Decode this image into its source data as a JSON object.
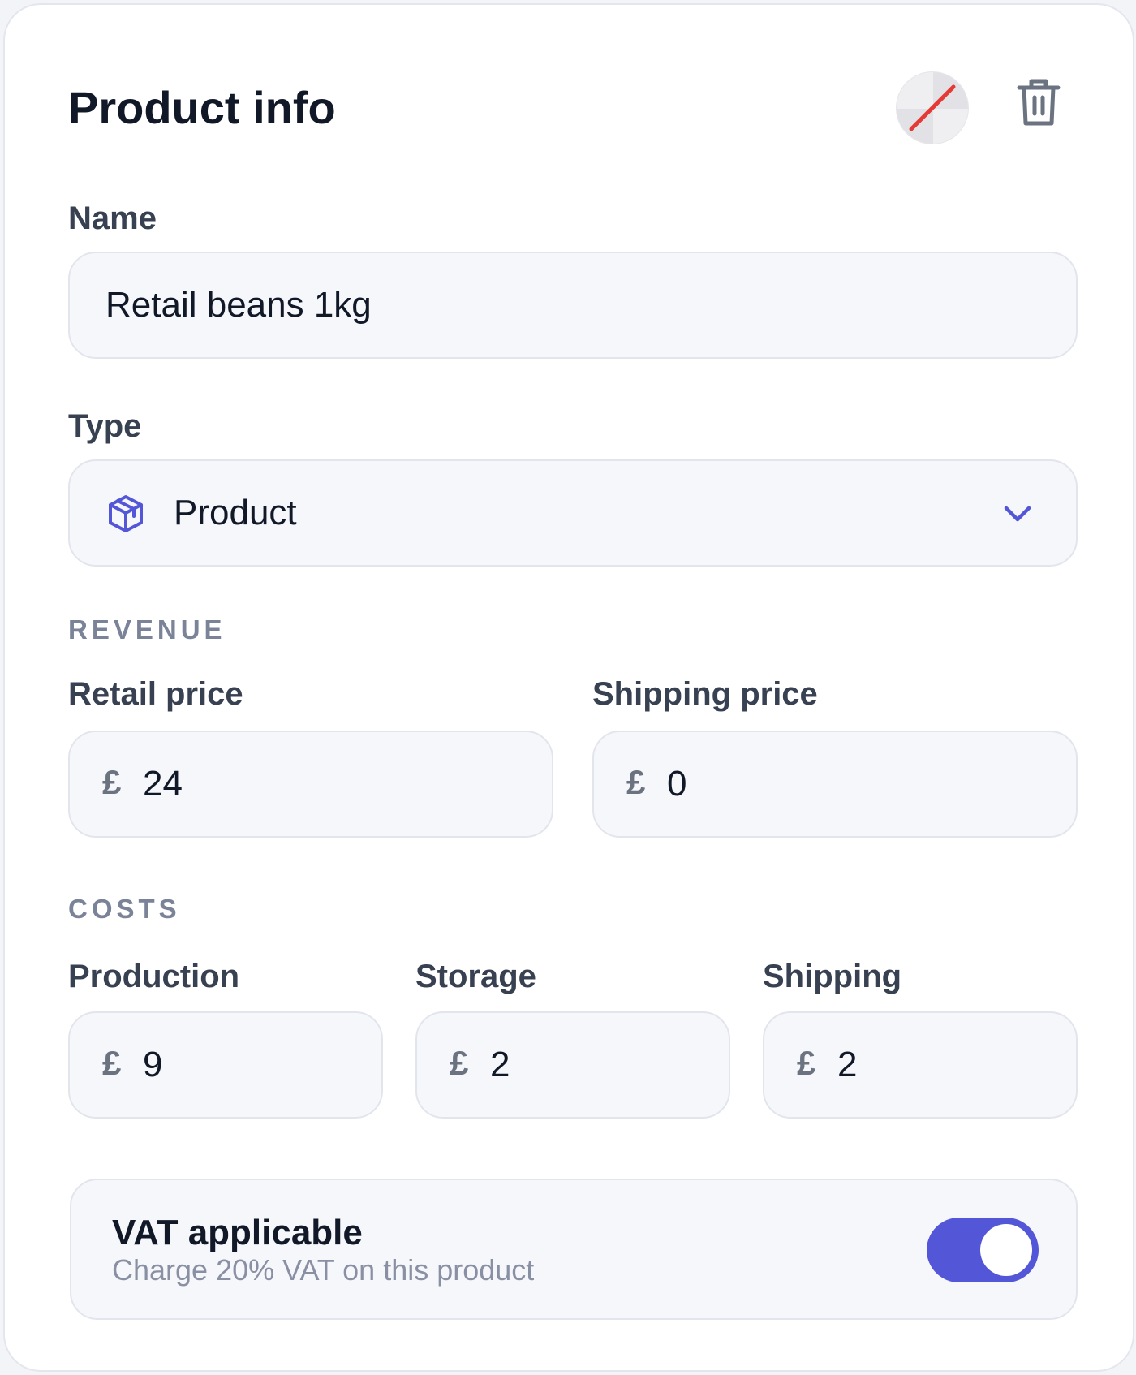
{
  "card": {
    "title": "Product info",
    "icons": {
      "color": "color-swatch-icon",
      "delete": "trash-icon"
    }
  },
  "name_field": {
    "label": "Name",
    "value": "Retail beans 1kg"
  },
  "type_field": {
    "label": "Type",
    "value": "Product",
    "icon": "package-icon",
    "chevron": "chevron-down-icon"
  },
  "revenue": {
    "heading": "REVENUE",
    "retail_price": {
      "label": "Retail price",
      "currency": "£",
      "value": "24"
    },
    "shipping_price": {
      "label": "Shipping price",
      "currency": "£",
      "value": "0"
    }
  },
  "costs": {
    "heading": "COSTS",
    "production": {
      "label": "Production",
      "currency": "£",
      "value": "9"
    },
    "storage": {
      "label": "Storage",
      "currency": "£",
      "value": "2"
    },
    "shipping": {
      "label": "Shipping",
      "currency": "£",
      "value": "2"
    }
  },
  "vat": {
    "title": "VAT applicable",
    "subtitle": "Charge 20% VAT on this product",
    "enabled": true
  },
  "colors": {
    "accent": "#5356d6",
    "text": "#111827",
    "field_bg": "#f6f7fb",
    "no_color_slash": "#e53935"
  }
}
